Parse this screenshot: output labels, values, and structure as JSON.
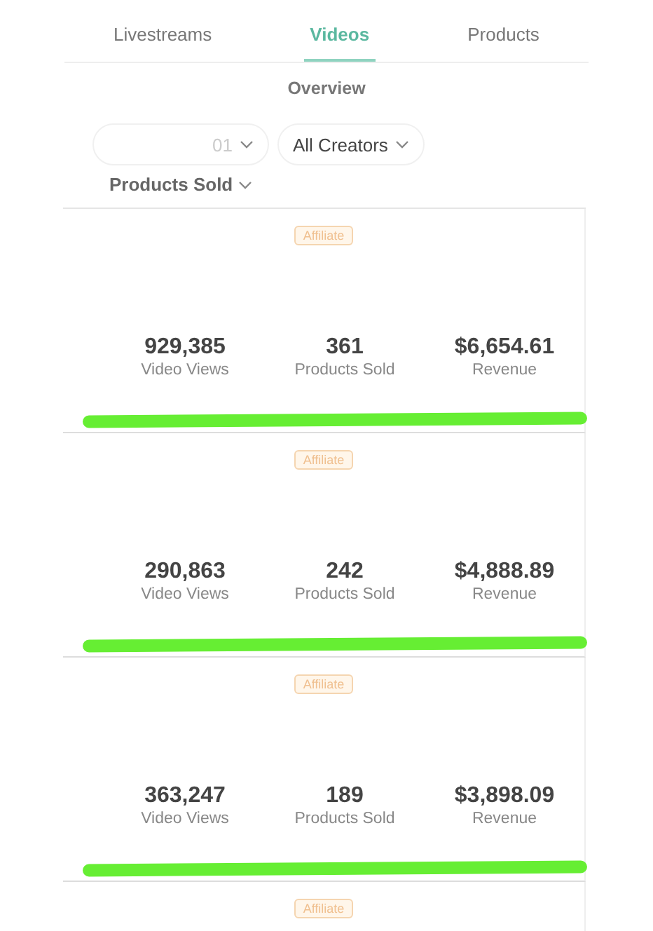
{
  "tabs": [
    {
      "label": "Livestreams",
      "selected": false
    },
    {
      "label": "Videos",
      "selected": true
    },
    {
      "label": "Products",
      "selected": false
    }
  ],
  "section_title": "Overview",
  "filters": [
    {
      "label": "01"
    },
    {
      "label": "All Creators"
    }
  ],
  "sort": {
    "label": "Products Sold"
  },
  "videos": [
    {
      "badge": "Affiliate",
      "stats": [
        {
          "value": "929,385",
          "label": "Video Views"
        },
        {
          "value": "361",
          "label": "Products Sold"
        },
        {
          "value": "$6,654.61",
          "label": "Revenue"
        }
      ]
    },
    {
      "badge": "Affiliate",
      "stats": [
        {
          "value": "290,863",
          "label": "Video Views"
        },
        {
          "value": "242",
          "label": "Products Sold"
        },
        {
          "value": "$4,888.89",
          "label": "Revenue"
        }
      ]
    },
    {
      "badge": "Affiliate",
      "stats": [
        {
          "value": "363,247",
          "label": "Video Views"
        },
        {
          "value": "189",
          "label": "Products Sold"
        },
        {
          "value": "$3,898.09",
          "label": "Revenue"
        }
      ]
    },
    {
      "badge": "Affiliate"
    }
  ]
}
